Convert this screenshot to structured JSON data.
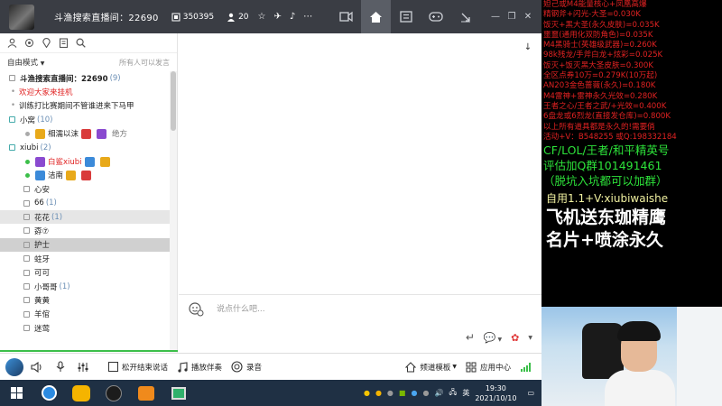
{
  "titlebar": {
    "room_title": "斗渔搜索直播间：22690",
    "stat_hot": "350395",
    "stat_users": "20",
    "icons": [
      "star-icon",
      "plane-icon",
      "bell-icon",
      "dots-icon",
      "video-icon",
      "home-icon",
      "list-icon",
      "gamepad-icon",
      "shrink-icon"
    ],
    "window_controls": [
      "minimize-icon",
      "restore-icon",
      "close-icon"
    ]
  },
  "left_panel": {
    "mode_label": "自由模式",
    "mode_right": "所有人可以发言",
    "channels": [
      {
        "type": "header",
        "name": "斗渔搜索直播间：22690",
        "count": "(9)",
        "bold": true
      },
      {
        "type": "sub",
        "name": "欢迎大家来挂机",
        "color": "#e02222"
      },
      {
        "type": "sub",
        "name": "训练打比赛期间不管谁进来下马甲",
        "color": "#222"
      },
      {
        "type": "group",
        "name": "小窝",
        "count": "(10)"
      },
      {
        "type": "user",
        "name": "相濡以沫",
        "extra": "绝方"
      },
      {
        "type": "group",
        "name": "xiubi",
        "count": "(2)"
      },
      {
        "type": "user",
        "name": "白鲨xiubi",
        "color": "#e02222"
      },
      {
        "type": "user",
        "name": "洁南"
      },
      {
        "type": "channel",
        "name": "心安"
      },
      {
        "type": "channel",
        "name": "66",
        "count": "(1)"
      },
      {
        "type": "channel",
        "name": "花花",
        "count": "(1)",
        "hl": true
      },
      {
        "type": "channel",
        "name": "孬⑦"
      },
      {
        "type": "channel",
        "name": "护士",
        "sel": true
      },
      {
        "type": "channel",
        "name": "蛀牙"
      },
      {
        "type": "channel",
        "name": "可可"
      },
      {
        "type": "channel",
        "name": "小哥哥",
        "count": "(1)"
      },
      {
        "type": "channel",
        "name": "黄黄"
      },
      {
        "type": "channel",
        "name": "羊倌"
      },
      {
        "type": "channel",
        "name": "迷莺"
      }
    ]
  },
  "chat": {
    "input_placeholder": "说点什么吧..."
  },
  "bottombar": {
    "end_talk": "松开结束说话",
    "play_music": "播放伴奏",
    "record": "录音",
    "channel_template": "频道模板",
    "app_center": "应用中心"
  },
  "taskbar": {
    "time": "19:30",
    "date": "2021/10/10",
    "lang": "英"
  },
  "overlay": {
    "red_lines": [
      "妲己或M4能量核心+凤凰高爆",
      "精钢斧+闪光-大圣=0.030K",
      "饭灭+黑大圣(永久皮肤)=0.035K",
      "噩噩(通用化双防角色)=0.035K",
      "M4黑骑士(英雄级武器)=0.260K",
      "98k残龙/手斧白龙+炫彩=0.025K",
      "饭灭+饭灭黑大圣皮肤=0.300K",
      "全区点券10万=0.279K(10万起)",
      "AN203金色蔷薇(永久)=0.180K",
      "M4雷神+雷神永久光效=0.280K",
      "王者之心/王者之武/+光效=0.400K",
      "6盘龙或6烈龙(直接发仓库)=0.800K",
      "以上所有道具都是永久的!需要倘",
      "活动+V：B548255   或Q:198332184"
    ],
    "green_lines": [
      "CF/LOL/王者/和平精英号",
      "评估加Q群101491461",
      "（脱坑入坑都可以加群）"
    ],
    "yellow_line": "自用1.1+V:xiubiwaishe",
    "white_lines": [
      "飞机送东珈精鹰",
      "名片+喷涂永久"
    ]
  }
}
